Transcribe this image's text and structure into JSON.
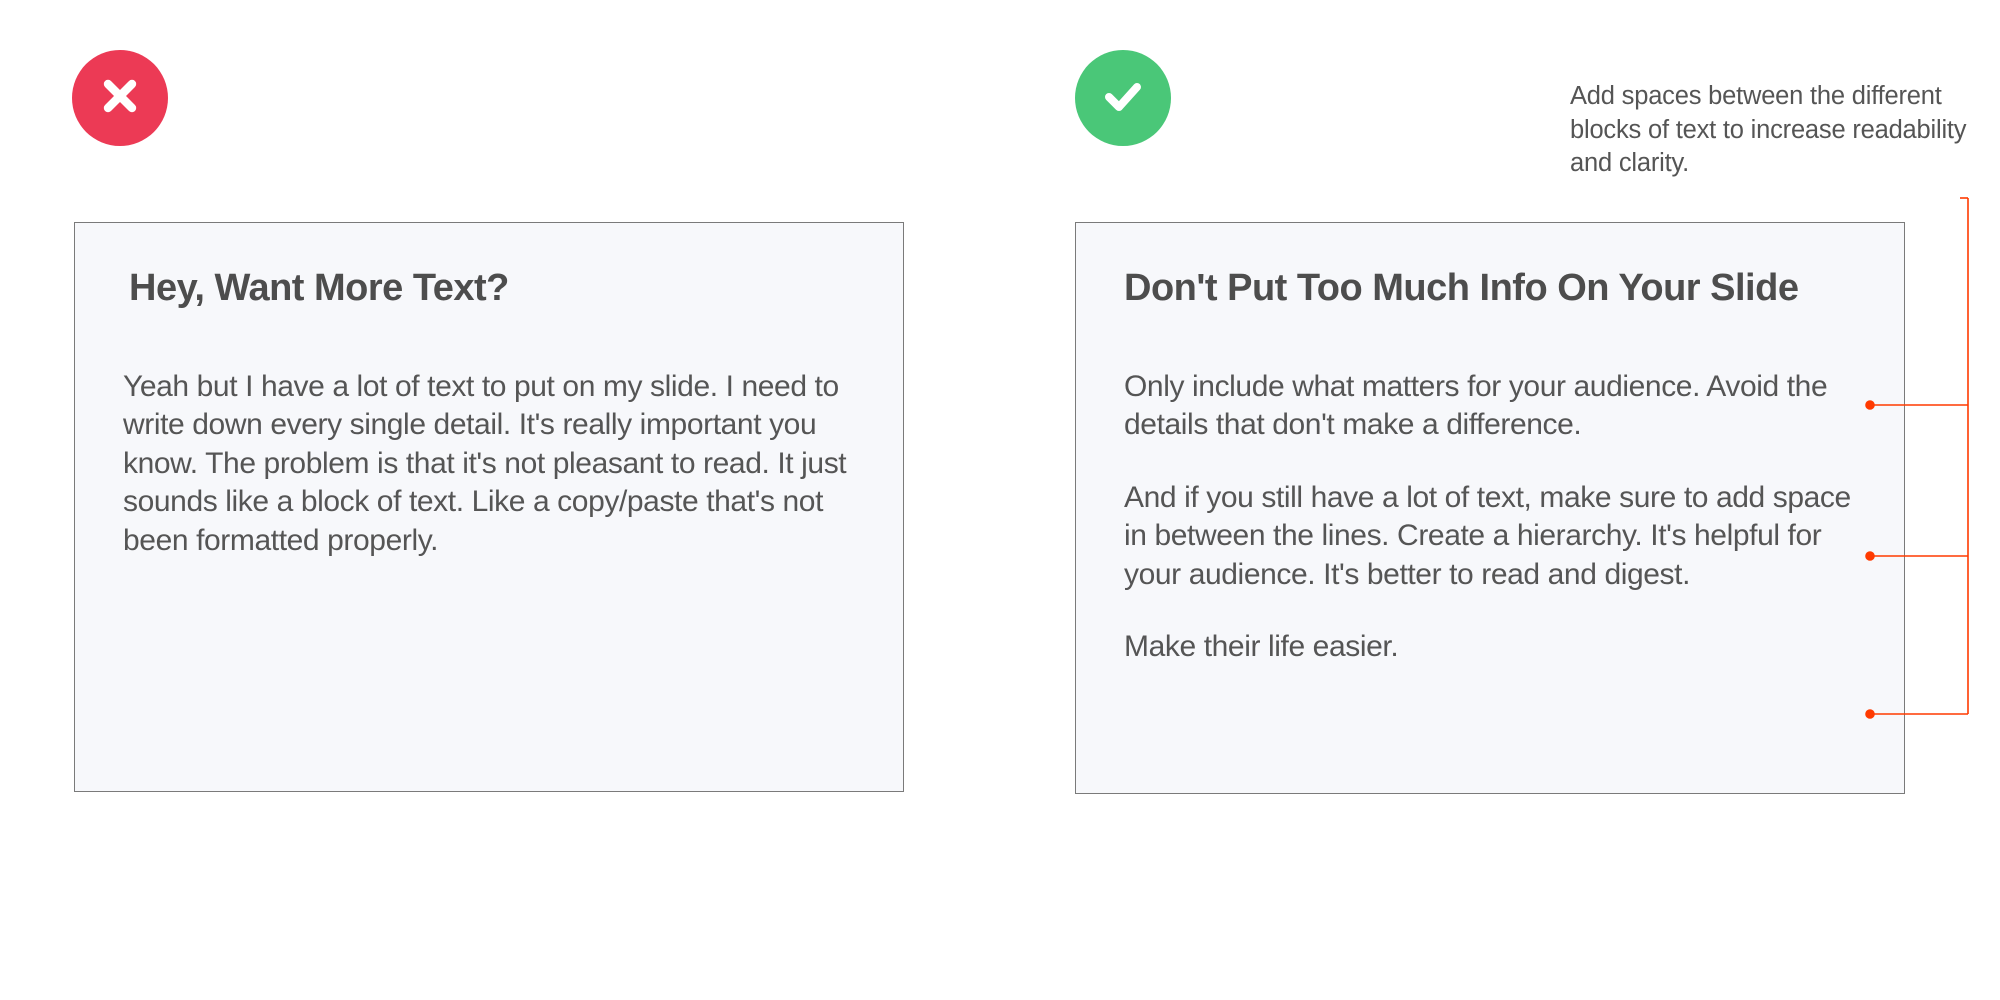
{
  "left": {
    "heading": "Hey, Want More Text?",
    "body": "Yeah but I have a lot of text to put on my slide. I need to write down every single detail. It's really important you know. The problem is that it's not pleasant to read. It just sounds like a block of text. Like a copy/paste that's not been formatted properly."
  },
  "right": {
    "heading": "Don't Put Too Much Info On Your Slide",
    "p1": "Only include what matters for your audience. Avoid the details that don't make a difference.",
    "p2": "And if you still have a lot of text, make sure to add space in between the lines. Create a hierarchy. It's helpful for your audience. It's better to read and digest.",
    "p3": "Make their life easier."
  },
  "annotation": "Add spaces between the different blocks of text to increase readability and clarity.",
  "colors": {
    "wrong": "#ec3a55",
    "right": "#4ac778",
    "callout": "#ff3a00"
  }
}
